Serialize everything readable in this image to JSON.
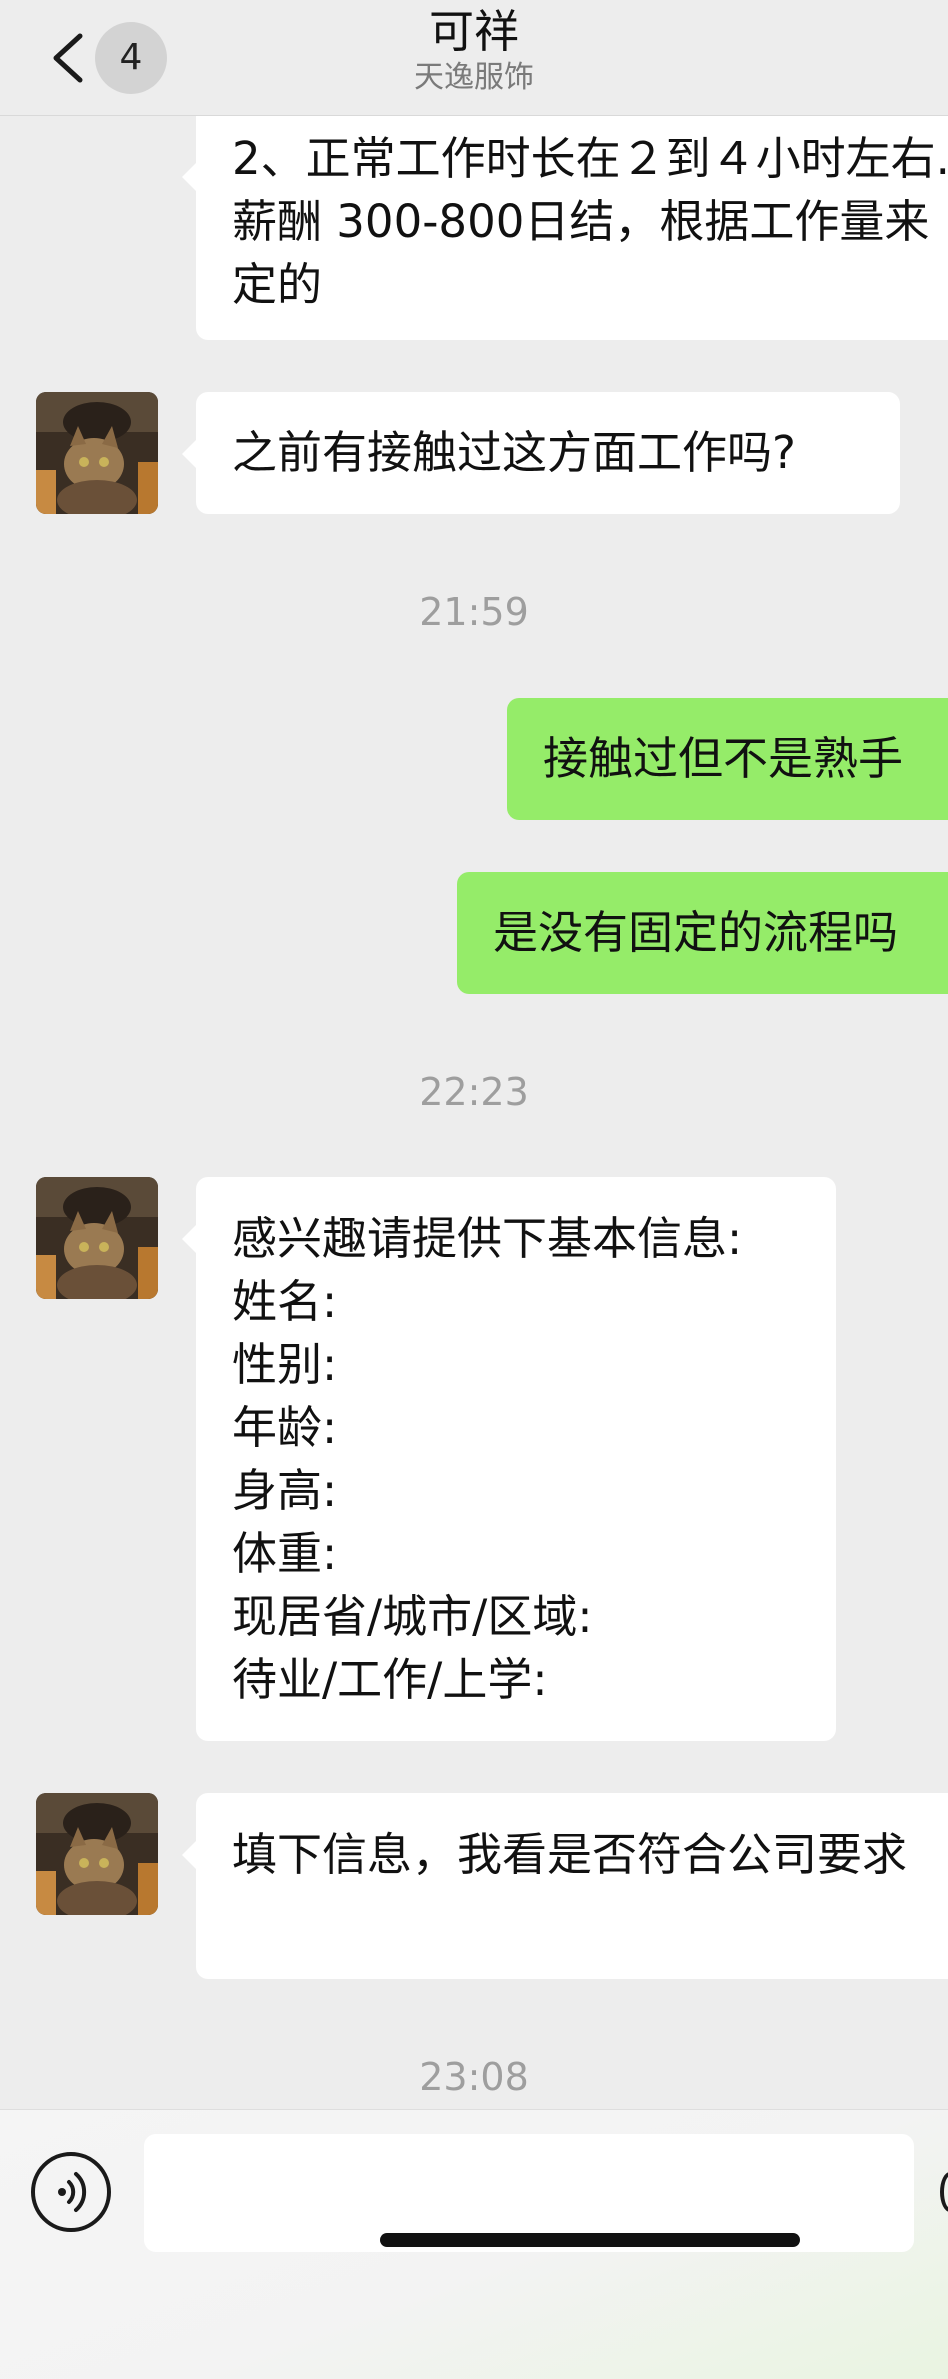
{
  "header": {
    "unread_count": "4",
    "title": "可祥",
    "subtitle": "天逸服饰"
  },
  "messages": [
    {
      "type": "incoming",
      "text": "2、正常工作时长在２到４小时左右.薪酬 300-800日结，根据工作量来定的"
    },
    {
      "type": "incoming",
      "text": "之前有接触过这方面工作吗?"
    },
    {
      "type": "timestamp",
      "text": "21:59"
    },
    {
      "type": "outgoing",
      "text": "接触过但不是熟手"
    },
    {
      "type": "outgoing",
      "text": "是没有固定的流程吗"
    },
    {
      "type": "timestamp",
      "text": "22:23"
    },
    {
      "type": "incoming",
      "text": "感兴趣请提供下基本信息:\n姓名:\n性别:\n年龄:\n身高:\n体重:\n现居省/城市/区域:\n待业/工作/上学:"
    },
    {
      "type": "incoming",
      "text": "填下信息，我看是否符合公司要求"
    },
    {
      "type": "timestamp",
      "text": "23:08"
    }
  ],
  "input": {
    "value": "",
    "placeholder": ""
  },
  "icons": {
    "back": "chevron-left-icon",
    "voice": "voice-icon",
    "emoji": "emoji-icon"
  },
  "colors": {
    "outgoing_bubble": "#95ec69",
    "incoming_bubble": "#ffffff",
    "background": "#ededed"
  }
}
